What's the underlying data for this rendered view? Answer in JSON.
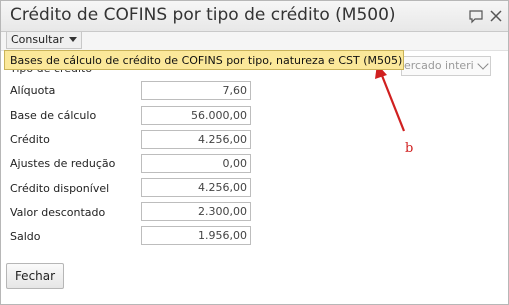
{
  "window": {
    "title": "Crédito de COFINS por tipo de crédito (M500)"
  },
  "toolbar": {
    "consultar_label": "Consultar"
  },
  "menu": {
    "item_label": "Bases de cálculo de crédito de COFINS por tipo, natureza e CST (M505)"
  },
  "form": {
    "tipo_label_partial": "Tipo de crédito",
    "select_partial_value": "ercado interi",
    "fields": [
      {
        "label": "Alíquota",
        "value": "7,60"
      },
      {
        "label": "Base de cálculo",
        "value": "56.000,00"
      },
      {
        "label": "Crédito",
        "value": "4.256,00"
      },
      {
        "label": "Ajustes de redução",
        "value": "0,00"
      },
      {
        "label": "Crédito disponível",
        "value": "4.256,00"
      },
      {
        "label": "Valor descontado",
        "value": "2.300,00"
      },
      {
        "label": "Saldo",
        "value": "1.956,00"
      }
    ]
  },
  "footer": {
    "close_label": "Fechar"
  },
  "annotation": {
    "letter": "b",
    "color": "#d02020"
  },
  "icons": [
    "comment-icon",
    "close-icon",
    "chevron-down-icon",
    "arrow-annotation"
  ]
}
